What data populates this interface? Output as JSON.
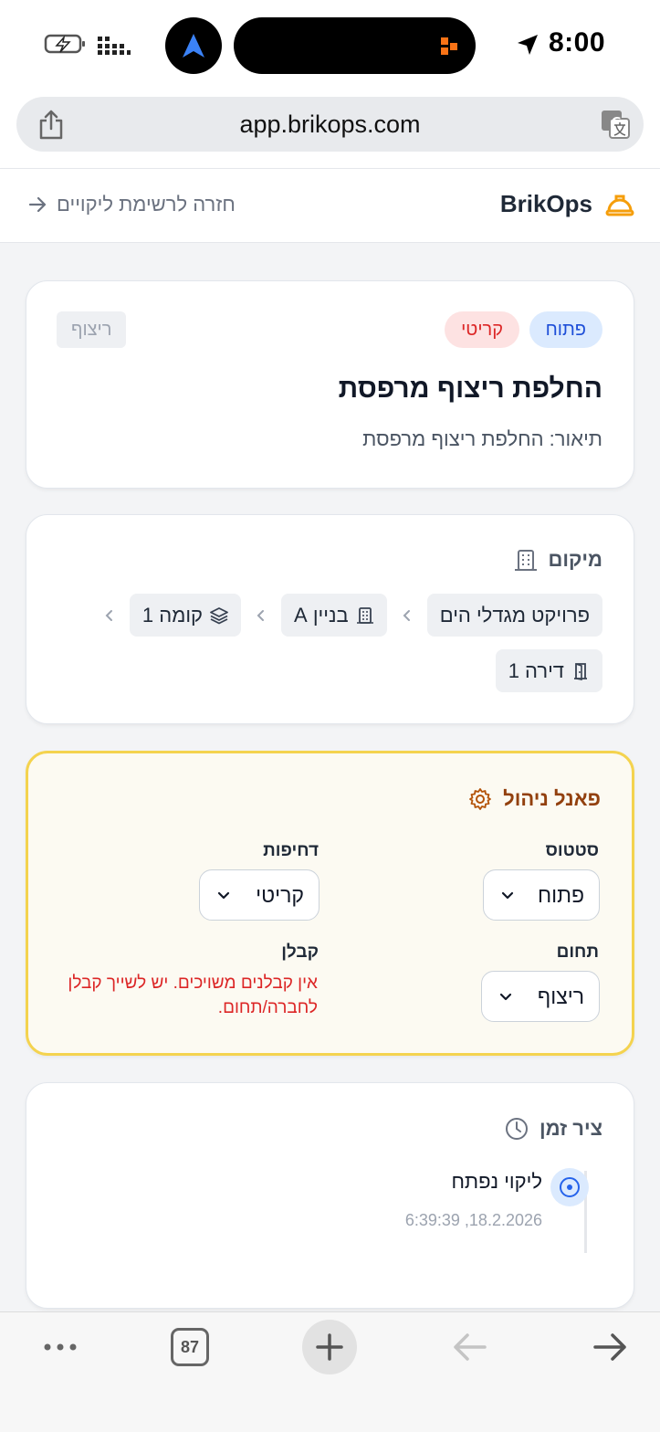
{
  "status_bar": {
    "time": "8:00"
  },
  "browser": {
    "url": "app.brikops.com"
  },
  "header": {
    "brand": "BrikOps",
    "back_label": "חזרה לרשימת ליקויים"
  },
  "issue": {
    "status_badge": "פתוח",
    "severity_badge": "קריטי",
    "category_badge": "ריצוף",
    "title": "החלפת ריצוף מרפסת",
    "description": "תיאור: החלפת ריצוף מרפסת"
  },
  "location": {
    "heading": "מיקום",
    "path": [
      {
        "label": "פרויקט מגדלי הים",
        "icon": "none"
      },
      {
        "label": "בניין A",
        "icon": "building-icon"
      },
      {
        "label": "קומה 1",
        "icon": "layers-icon"
      },
      {
        "label": "דירה 1",
        "icon": "door-icon"
      }
    ]
  },
  "admin": {
    "heading": "פאנל ניהול",
    "status_label": "סטטוס",
    "status_value": "פתוח",
    "priority_label": "דחיפות",
    "priority_value": "קריטי",
    "domain_label": "תחום",
    "domain_value": "ריצוף",
    "contractor_label": "קבלן",
    "contractor_error": "אין קבלנים משויכים. יש לשייך קבלן לחברה/תחום."
  },
  "timeline": {
    "heading": "ציר זמן",
    "events": [
      {
        "title": "ליקוי נפתח",
        "time": "18.2.2026, 6:39:39"
      }
    ]
  },
  "toolbar": {
    "tab_count": "87"
  },
  "colors": {
    "accent_blue": "#1d4ed8",
    "critical_red": "#dc2626",
    "admin_border": "#f4d34f",
    "brand_orange": "#f59e0b"
  }
}
